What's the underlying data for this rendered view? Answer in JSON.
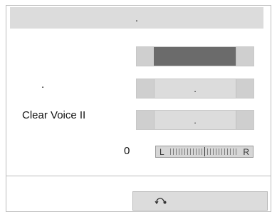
{
  "title": ".",
  "rows": [
    {
      "label": "",
      "value": ""
    },
    {
      "label": ".",
      "value": "."
    },
    {
      "label": "Clear Voice II",
      "value": "."
    }
  ],
  "balance": {
    "value": "0",
    "left": "L",
    "right": "R",
    "level": 0.5
  },
  "footer": {
    "icon": "reset-icon"
  }
}
